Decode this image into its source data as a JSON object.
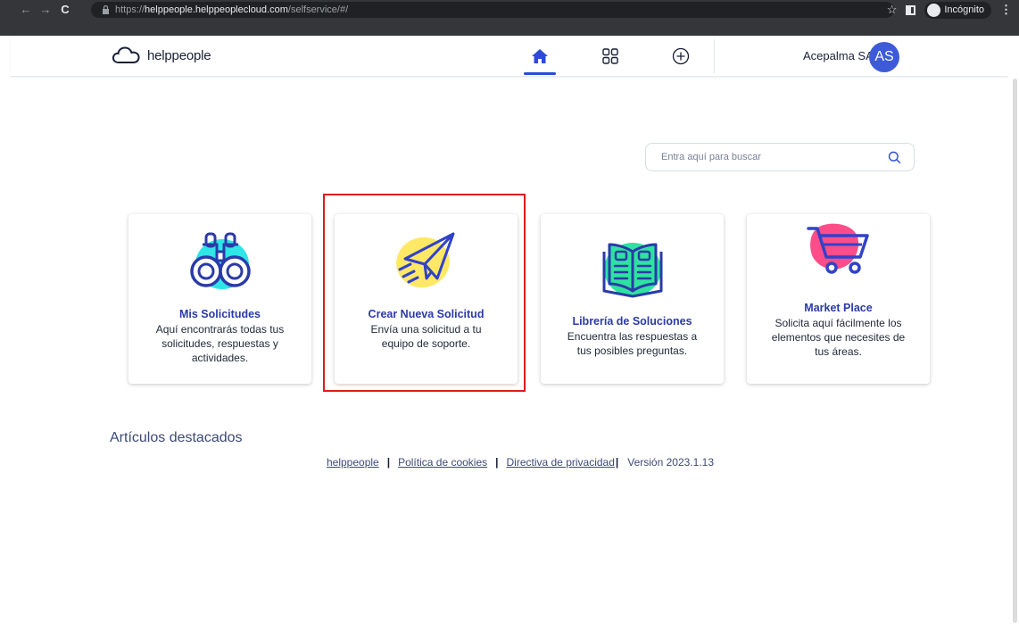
{
  "browser": {
    "url_scheme": "https://",
    "url_host": "helppeople.helppeoplecloud.com",
    "url_path": "/selfservice/#/",
    "incognito_label": "Incógnito"
  },
  "header": {
    "logo_text": "helppeople",
    "company": "Acepalma SA",
    "avatar_initials": "AS",
    "accent": "#2c4bd8",
    "nav": [
      "home-icon",
      "apps-grid-icon",
      "add-circle-icon"
    ]
  },
  "search": {
    "placeholder": "Entra aquí para buscar"
  },
  "cards": [
    {
      "title": "Mis Solicitudes",
      "desc": "Aquí encontrarás todas tus solicitudes, respuestas y actividades.",
      "icon": "binoculars-icon"
    },
    {
      "title": "Crear Nueva Solicitud",
      "desc": "Envía una solicitud a tu equipo de soporte.",
      "icon": "paper-plane-icon"
    },
    {
      "title": "Librería de Soluciones",
      "desc": "Encuentra las respuestas a tus posibles preguntas.",
      "icon": "open-book-icon"
    },
    {
      "title": "Market Place",
      "desc": "Solicita aquí fácilmente los elementos que necesites de tus áreas.",
      "icon": "shopping-cart-icon"
    }
  ],
  "featured": {
    "title": "Artículos destacados"
  },
  "footer": {
    "link_home": "helppeople",
    "link_cookies": "Política de cookies",
    "link_privacy": "Directiva de privacidad",
    "version": "Versión 2023.1.13"
  },
  "highlight_color": "#e11b1b"
}
